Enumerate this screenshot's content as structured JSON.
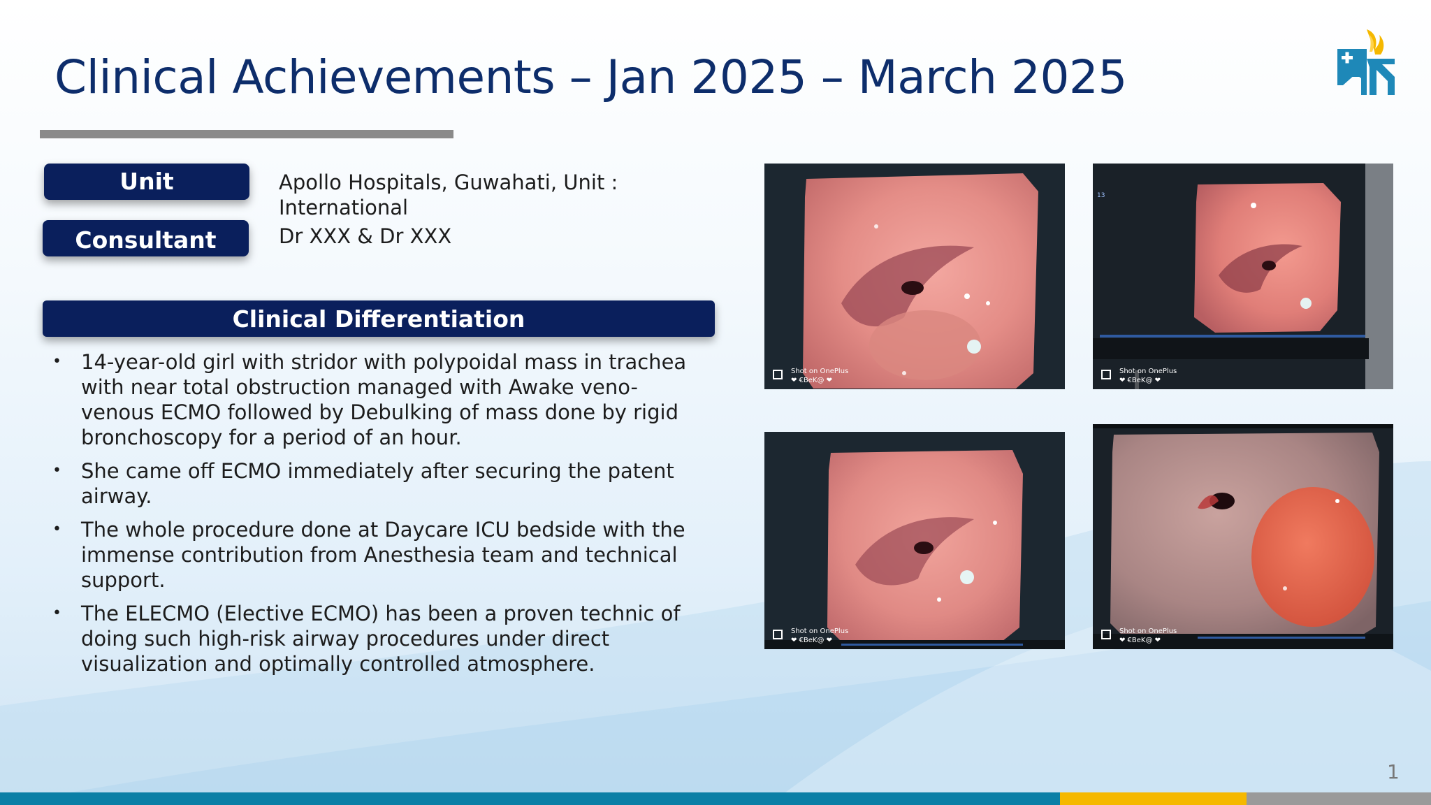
{
  "slide": {
    "title": "Clinical Achievements – Jan 2025 – March 2025",
    "page_number": "1"
  },
  "info": {
    "unit_label": "Unit",
    "unit_value": "Apollo Hospitals, Guwahati, Unit : International",
    "consultant_label": "Consultant",
    "consultant_value": "Dr XXX & Dr XXX"
  },
  "section": {
    "heading": "Clinical Differentiation",
    "bullets": [
      "14-year-old girl with stridor with polypoidal mass in trachea with near total obstruction managed with Awake veno-venous ECMO followed by Debulking of mass done by rigid bronchoscopy for a period of an hour.",
      "She came off ECMO immediately after securing the patent airway.",
      "The whole procedure done at Daycare ICU bedside with the immense contribution from Anesthesia team and technical support.",
      "The ELECMO (Elective ECMO) has been a proven technic of doing such high-risk airway procedures under direct visualization and optimally controlled atmosphere."
    ]
  },
  "photos": [
    {
      "watermark_line1": "Shot on OnePlus",
      "watermark_line2": "❤ €BeK@ ❤"
    },
    {
      "watermark_line1": "Shot on OnePlus",
      "watermark_line2": "❤ €BeK@ ❤"
    },
    {
      "watermark_line1": "Shot on OnePlus",
      "watermark_line2": "❤ €BeK@ ❤"
    },
    {
      "watermark_line1": "Shot on OnePlus",
      "watermark_line2": "❤ €BeK@ ❤"
    }
  ],
  "colors": {
    "title": "#0d2d6b",
    "pill": "#0a1f5c",
    "footer_blue": "#0b7fa6",
    "footer_yellow": "#f5b800",
    "footer_gray": "#9a9a9a"
  },
  "icons": {
    "logo": "hospital-logo-icon",
    "bullet": "bullet-dot-icon"
  }
}
